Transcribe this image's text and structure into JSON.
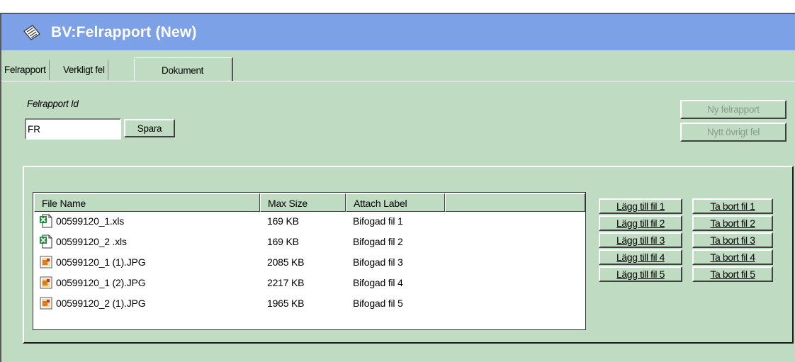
{
  "window": {
    "title": "BV:Felrapport (New)"
  },
  "tabs": [
    {
      "label": "Felrapport"
    },
    {
      "label": "Verkligt fel"
    },
    {
      "label": "Dokument"
    }
  ],
  "form": {
    "id_label": "Felrapport Id",
    "id_value": "FR",
    "save_label": "Spara",
    "new_report_label": "Ny felrapport",
    "new_other_fault_label": "Nytt övrigt fel"
  },
  "attachments": {
    "columns": [
      "File Name",
      "Max Size",
      "Attach Label"
    ],
    "rows": [
      {
        "name": "00599120_1.xls",
        "size": "169 KB",
        "label": "Bifogad fil 1",
        "icon": "excel-file-icon"
      },
      {
        "name": "00599120_2 .xls",
        "size": "169 KB",
        "label": "Bifogad fil 2",
        "icon": "excel-file-icon"
      },
      {
        "name": "00599120_1 (1).JPG",
        "size": "2085 KB",
        "label": "Bifogad fil 3",
        "icon": "image-file-icon"
      },
      {
        "name": "00599120_1 (2).JPG",
        "size": "2217 KB",
        "label": "Bifogad fil 4",
        "icon": "image-file-icon"
      },
      {
        "name": "00599120_2 (1).JPG",
        "size": "1965 KB",
        "label": "Bifogad fil 5",
        "icon": "image-file-icon"
      }
    ],
    "add_buttons": [
      "Lägg till fil 1",
      "Lägg till fil 2",
      "Lägg till fil 3",
      "Lägg till fil 4",
      "Lägg till fil 5"
    ],
    "remove_buttons": [
      "Ta bort fil 1",
      "Ta bort fil 2",
      "Ta bort fil 3",
      "Ta bort fil 4",
      "Ta bort fil 5"
    ]
  },
  "colors": {
    "titlebar": "#7da1e6",
    "background": "#bfdbc1",
    "excel_green": "#1f8a3a",
    "image_orange": "#e07a1e"
  }
}
